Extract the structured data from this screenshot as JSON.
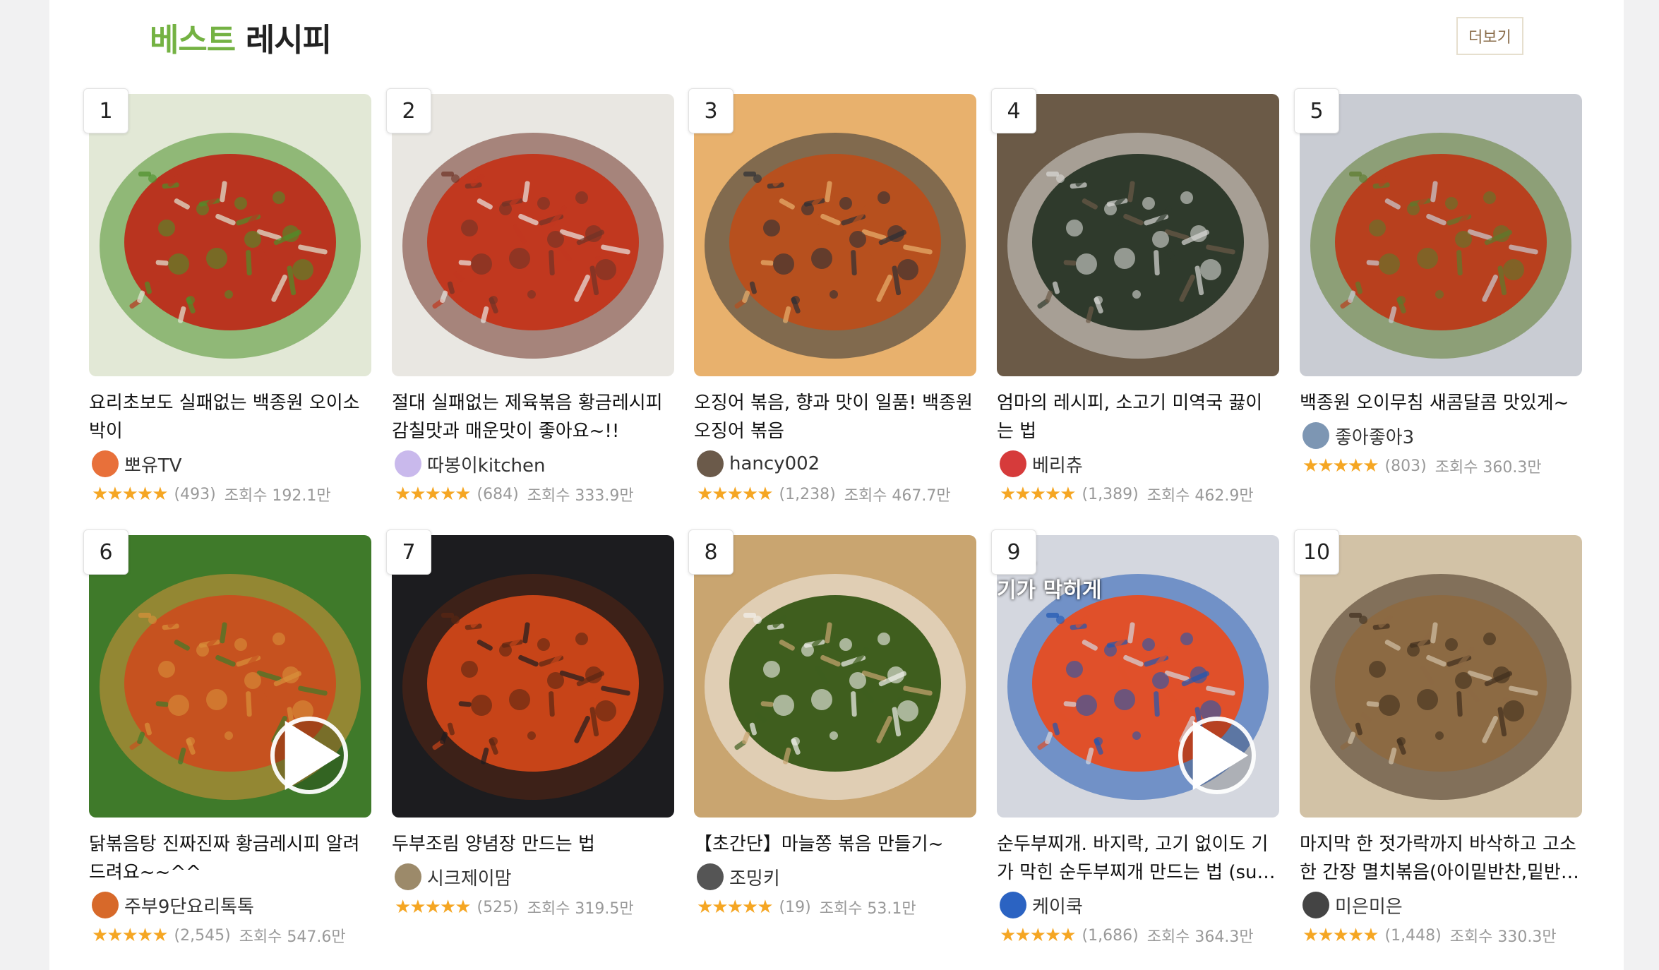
{
  "section": {
    "title_accent": "베스트",
    "title_rest": " 레시피",
    "more_label": "더보기"
  },
  "recipes": [
    {
      "rank": "1",
      "title": "요리초보도 실패없는 백종원 오이소박이",
      "author": "뽀유TV",
      "rating": 5,
      "reviews": "(493)",
      "views": "조회수 192.1만",
      "has_video": false,
      "colors": [
        "#b9341f",
        "#4d8f2a",
        "#e2e8d6"
      ],
      "avatar_color": "#e8703a"
    },
    {
      "rank": "2",
      "title": "절대 실패없는 제육볶음 황금레시피 감칠맛과 매운맛이 좋아요~!!",
      "author": "따봉이kitchen",
      "rating": 5,
      "reviews": "(684)",
      "views": "조회수 333.9만",
      "has_video": false,
      "colors": [
        "#c1381f",
        "#6f3326",
        "#e9e7e2"
      ],
      "avatar_color": "#c9b9ec"
    },
    {
      "rank": "3",
      "title": "오징어 볶음, 향과 맛이 일품! 백종원 오징어 볶음",
      "author": "hancy002",
      "rating": 5,
      "reviews": "(1,238)",
      "views": "조회수 467.7만",
      "has_video": false,
      "colors": [
        "#b7501e",
        "#2c2f35",
        "#e8b16d"
      ],
      "avatar_color": "#6b5a4a"
    },
    {
      "rank": "4",
      "title": "엄마의 레시피, 소고기 미역국 끓이는 법",
      "author": "베리츄",
      "rating": 5,
      "reviews": "(1,389)",
      "views": "조회수 462.9만",
      "has_video": false,
      "colors": [
        "#2f3a2c",
        "#d9d9d6",
        "#6b5a47"
      ],
      "avatar_color": "#d63b3b"
    },
    {
      "rank": "5",
      "title": "백종원 오이무침 새콤달콤 맛있게~",
      "author": "좋아좋아3",
      "rating": 5,
      "reviews": "(803)",
      "views": "조회수 360.3만",
      "has_video": false,
      "colors": [
        "#b8401e",
        "#5b7a2c",
        "#c9ccd3"
      ],
      "avatar_color": "#7d96b3"
    },
    {
      "rank": "6",
      "title": "닭볶음탕 진짜진짜 황금레시피 알려 드려요~~^^",
      "author": "주부9단요리톡톡",
      "rating": 5,
      "reviews": "(2,545)",
      "views": "조회수 547.6만",
      "has_video": true,
      "colors": [
        "#c6521f",
        "#d8913b",
        "#3f7a2a"
      ],
      "avatar_color": "#d7692a"
    },
    {
      "rank": "7",
      "title": "두부조림 양념장 만드는 법",
      "author": "시크제이맘",
      "rating": 5,
      "reviews": "(525)",
      "views": "조회수 319.5만",
      "has_video": false,
      "colors": [
        "#c74418",
        "#5a2613",
        "#1c1c1f"
      ],
      "avatar_color": "#9c8a6a"
    },
    {
      "rank": "8",
      "title": "【초간단】마늘쫑 볶음 만들기~",
      "author": "조밍키",
      "rating": 5,
      "reviews": "(19)",
      "views": "조회수 53.1만",
      "has_video": false,
      "colors": [
        "#3f5e1e",
        "#f2f1ec",
        "#c9a570"
      ],
      "avatar_color": "#555555"
    },
    {
      "rank": "9",
      "title": "순두부찌개. 바지락, 고기 없이도 기가 막힌 순두부찌개 만드는 법 (sundubujjigae)",
      "author": "케이쿡",
      "rating": 5,
      "reviews": "(1,686)",
      "views": "조회수 364.3만",
      "has_video": true,
      "colors": [
        "#e0502a",
        "#1f57b3",
        "#d4d7df"
      ],
      "avatar_color": "#2b63c2",
      "overlay_text": "이도\n기가 막히게"
    },
    {
      "rank": "10",
      "title": "마지막 한 젓가락까지 바삭하고 고소한 간장 멸치볶음(아이밑반찬,밑반찬)",
      "author": "미은미은",
      "rating": 5,
      "reviews": "(1,448)",
      "views": "조회수 330.3만",
      "has_video": false,
      "colors": [
        "#8c6a43",
        "#3f2e1c",
        "#d2c2a6"
      ],
      "avatar_color": "#444444"
    }
  ]
}
